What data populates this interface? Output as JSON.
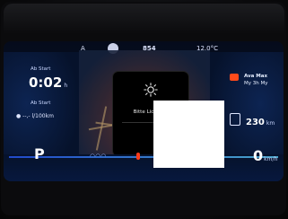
{
  "status": {
    "label": "A",
    "range_top": "854",
    "temperature": "12.0°C"
  },
  "left": {
    "ab_start_label": "Ab Start",
    "ab_start_time": "0:02",
    "ab_start_time_suffix": "h",
    "ab_start_label2": "Ab Start",
    "ab_start_consumption": "--,- l/100km"
  },
  "center": {
    "popup_text": "Bitte Licht ein"
  },
  "right": {
    "assist_label_1": "Ava Max",
    "assist_label_2": "My 3h My",
    "range_value": "230",
    "range_unit": "km"
  },
  "bottom": {
    "gear": "P",
    "speed": "0",
    "speed_unit": "km/h"
  },
  "colors": {
    "accent_blue": "#2a5cff",
    "warning_orange": "#ff4a1a"
  }
}
